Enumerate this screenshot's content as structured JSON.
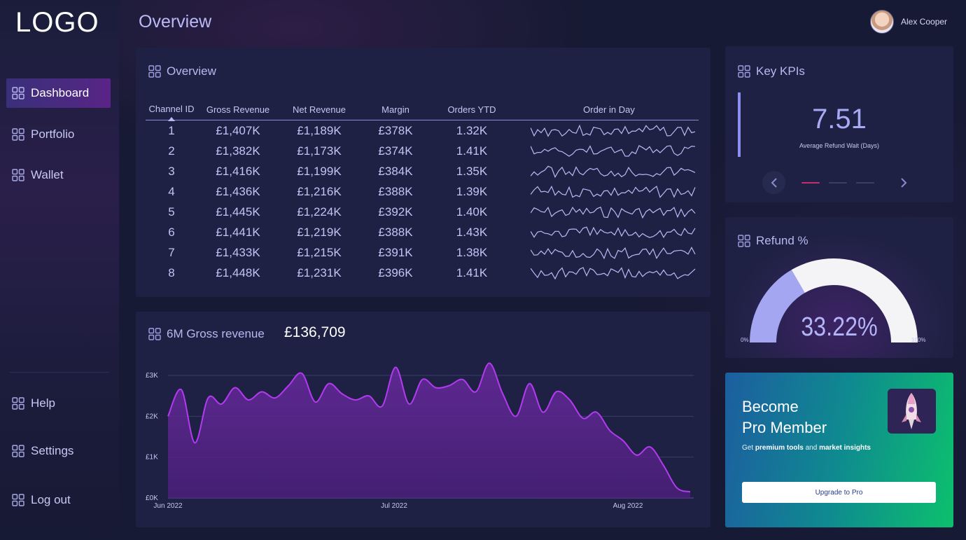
{
  "logo": "LOGO",
  "page_title": "Overview",
  "user": {
    "name": "Alex Cooper"
  },
  "sidebar": {
    "top_items": [
      {
        "label": "Dashboard",
        "active": true
      },
      {
        "label": "Portfolio",
        "active": false
      },
      {
        "label": "Wallet",
        "active": false
      }
    ],
    "bottom_items": [
      {
        "label": "Help"
      },
      {
        "label": "Settings"
      },
      {
        "label": "Log out"
      }
    ]
  },
  "overview": {
    "title": "Overview",
    "columns": [
      "Channel ID",
      "Gross Revenue",
      "Net Revenue",
      "Margin",
      "Orders YTD",
      "Order in Day"
    ],
    "sorted_column": "Channel ID",
    "rows": [
      {
        "id": "1",
        "gross": "£1,407K",
        "net": "£1,189K",
        "margin": "£378K",
        "orders": "1.32K"
      },
      {
        "id": "2",
        "gross": "£1,382K",
        "net": "£1,173K",
        "margin": "£374K",
        "orders": "1.41K"
      },
      {
        "id": "3",
        "gross": "£1,416K",
        "net": "£1,199K",
        "margin": "£384K",
        "orders": "1.35K"
      },
      {
        "id": "4",
        "gross": "£1,436K",
        "net": "£1,216K",
        "margin": "£388K",
        "orders": "1.39K"
      },
      {
        "id": "5",
        "gross": "£1,445K",
        "net": "£1,224K",
        "margin": "£392K",
        "orders": "1.40K"
      },
      {
        "id": "6",
        "gross": "£1,441K",
        "net": "£1,219K",
        "margin": "£388K",
        "orders": "1.43K"
      },
      {
        "id": "7",
        "gross": "£1,433K",
        "net": "£1,215K",
        "margin": "£391K",
        "orders": "1.38K"
      },
      {
        "id": "8",
        "gross": "£1,448K",
        "net": "£1,231K",
        "margin": "£396K",
        "orders": "1.41K"
      }
    ]
  },
  "revenue": {
    "title": "6M Gross revenue",
    "amount": "£136,709"
  },
  "chart_data": {
    "type": "area",
    "title": "6M Gross revenue",
    "x_tick_labels": [
      "Jun 2022",
      "Jul 2022",
      "Aug 2022"
    ],
    "y_tick_labels": [
      "£0K",
      "£1K",
      "£2K",
      "£3K"
    ],
    "ylim": [
      0,
      3000
    ],
    "grid": true,
    "color": "#b33af0",
    "x": [
      "2022-06-01",
      "2022-06-03",
      "2022-06-05",
      "2022-06-07",
      "2022-06-09",
      "2022-06-11",
      "2022-06-13",
      "2022-06-15",
      "2022-06-17",
      "2022-06-19",
      "2022-06-21",
      "2022-06-23",
      "2022-06-25",
      "2022-06-27",
      "2022-06-29",
      "2022-07-01",
      "2022-07-03",
      "2022-07-05",
      "2022-07-07",
      "2022-07-09",
      "2022-07-11",
      "2022-07-13",
      "2022-07-15",
      "2022-07-17",
      "2022-07-19",
      "2022-07-21",
      "2022-07-23",
      "2022-07-25",
      "2022-07-27",
      "2022-07-29",
      "2022-07-31",
      "2022-08-02",
      "2022-08-04",
      "2022-08-06",
      "2022-08-08",
      "2022-08-10",
      "2022-08-12",
      "2022-08-14",
      "2022-08-16",
      "2022-08-18"
    ],
    "values": [
      2000,
      2650,
      1350,
      2450,
      2300,
      2700,
      2400,
      2600,
      2450,
      2750,
      3050,
      2350,
      2800,
      2550,
      2400,
      2500,
      2250,
      3200,
      2300,
      2900,
      2700,
      2750,
      2900,
      2600,
      3300,
      2550,
      2000,
      2800,
      2100,
      2600,
      2400,
      1950,
      2100,
      1650,
      1400,
      1050,
      1250,
      800,
      250,
      150
    ],
    "y_positions_note": ""
  },
  "kpis": {
    "title": "Key KPIs",
    "value": "7.51",
    "label": "Average Refund Wait (Days)",
    "slide_index": 1,
    "slide_count": 3
  },
  "refund": {
    "title": "Refund %",
    "value": "33.22%",
    "fraction": 0.3322,
    "min_label": "0%",
    "max_label": "100%"
  },
  "promo": {
    "title_line1": "Become",
    "title_line2": "Pro Member",
    "sub_prefix": "Get",
    "sub_bold1": "premium tools",
    "sub_mid": "and",
    "sub_bold2": "market insights",
    "button": "Upgrade to Pro"
  },
  "colors": {
    "accent": "#b33af0",
    "gauge_fill": "#a4a6f2",
    "gauge_track": "#f4f4f6",
    "kpi_active_dot": "#c0306e"
  }
}
